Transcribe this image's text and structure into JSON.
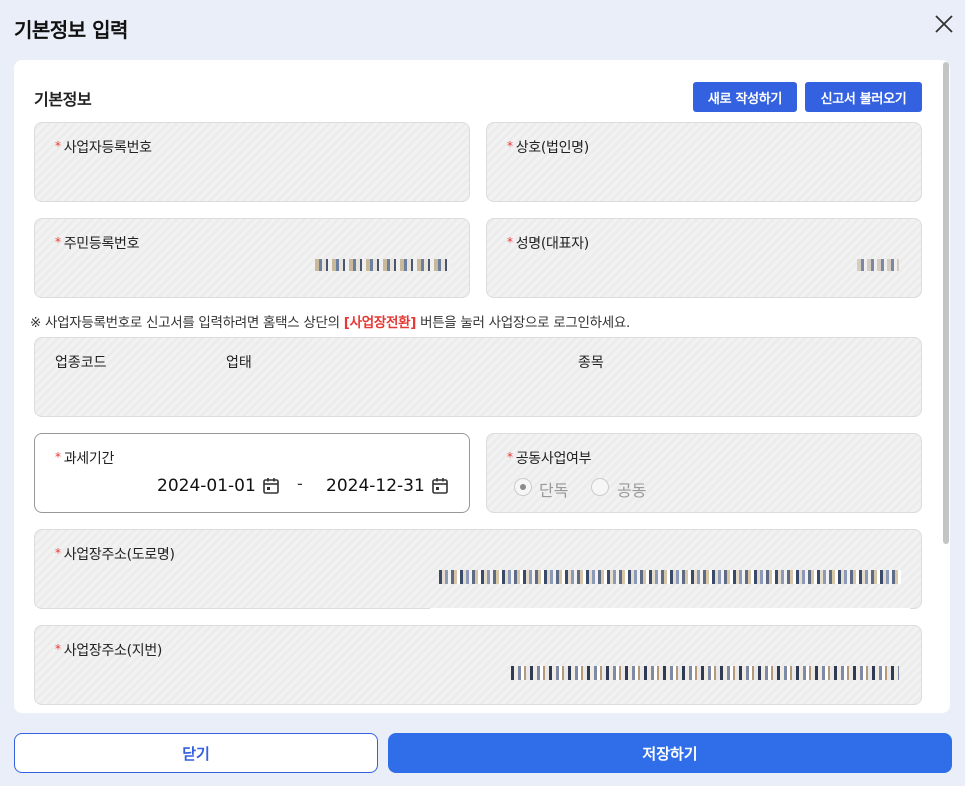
{
  "dialog": {
    "title": "기본정보 입력"
  },
  "section": {
    "title": "기본정보",
    "new_button": "새로 작성하기",
    "load_button": "신고서 불러오기"
  },
  "fields": {
    "business_reg_no": "사업자등록번호",
    "company_name": "상호(법인명)",
    "resident_reg_no": "주민등록번호",
    "representative": "성명(대표자)",
    "tax_period": "과세기간",
    "joint_business": "공동사업여부",
    "address_road": "사업장주소(도로명)",
    "address_lot": "사업장주소(지번)"
  },
  "notice": {
    "before": "※ 사업자등록번호로 신고서를 입력하려면 홈택스 상단의 ",
    "highlight": "[사업장전환]",
    "after": " 버튼을 눌러 사업장으로 로그인하세요."
  },
  "industry": {
    "code_header": "업종코드",
    "type_header": "업태",
    "item_header": "종목"
  },
  "tax_period": {
    "start": "2024-01-01",
    "separator": "-",
    "end": "2024-12-31"
  },
  "joint": {
    "option_single": "단독",
    "option_joint": "공동",
    "selected": "단독"
  },
  "footer": {
    "close_label": "닫기",
    "save_label": "저장하기"
  },
  "colors": {
    "accent": "#3461e0",
    "required": "#e53935",
    "save": "#2f6ee8"
  },
  "icons": {
    "close": "close-icon",
    "calendar": "calendar-icon"
  }
}
